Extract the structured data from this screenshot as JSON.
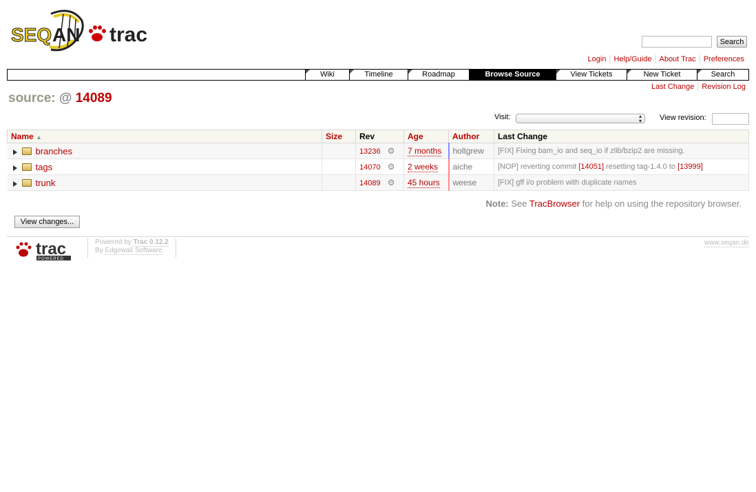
{
  "logo": {
    "brand_name": "SEQAN",
    "product_name": "trac"
  },
  "search": {
    "input_value": "",
    "button_label": "Search"
  },
  "metanav": [
    {
      "label": "Login"
    },
    {
      "label": "Help/Guide"
    },
    {
      "label": "About Trac"
    },
    {
      "label": "Preferences"
    }
  ],
  "mainnav": [
    {
      "label": "Wiki",
      "active": false
    },
    {
      "label": "Timeline",
      "active": false
    },
    {
      "label": "Roadmap",
      "active": false
    },
    {
      "label": "Browse Source",
      "active": true
    },
    {
      "label": "View Tickets",
      "active": false
    },
    {
      "label": "New Ticket",
      "active": false
    },
    {
      "label": "Search",
      "active": false
    }
  ],
  "ctxtnav": [
    {
      "label": "Last Change"
    },
    {
      "label": "Revision Log"
    }
  ],
  "title": {
    "label": "source:",
    "at": "@",
    "revision": "14089"
  },
  "visit": {
    "label": "Visit:",
    "selected": ""
  },
  "view_revision": {
    "label": "View revision:",
    "value": ""
  },
  "table": {
    "headers": {
      "name": "Name",
      "size": "Size",
      "rev": "Rev",
      "age": "Age",
      "author": "Author",
      "last_change": "Last Change"
    },
    "sort_indicator": "▲",
    "rows": [
      {
        "name": "branches",
        "size": "",
        "rev": "13236",
        "age": "7 months",
        "author": "holtgrew",
        "change": "[FIX] Fixing bam_io and seq_io if zlib/bzip2 are missing.",
        "age_color": "#8888ff"
      },
      {
        "name": "tags",
        "size": "",
        "rev": "14070",
        "age": "2 weeks",
        "author": "aiche",
        "change_prefix": "[NOP] reverting commit ",
        "change_link1": "[14051]",
        "change_mid": " resetting tag-1.4.0 to ",
        "change_link2": "[13999]",
        "age_color": "#ff8888"
      },
      {
        "name": "trunk",
        "size": "",
        "rev": "14089",
        "age": "45 hours",
        "author": "weese",
        "change": "[FIX] gff i/o problem with duplicate names",
        "age_color": "#ff8888"
      }
    ]
  },
  "help": {
    "note_label": "Note:",
    "see": "See",
    "link": "TracBrowser",
    "rest": "for help on using the repository browser."
  },
  "view_changes_button": "View changes...",
  "footer": {
    "trac_logo_text": "trac",
    "trac_logo_sub": "POWERED",
    "powered_by": "Powered by",
    "trac_version": "Trac 0.12.2",
    "by": "By",
    "edgewall": "Edgewall Software",
    "period": ".",
    "site": "www.seqan.de"
  }
}
